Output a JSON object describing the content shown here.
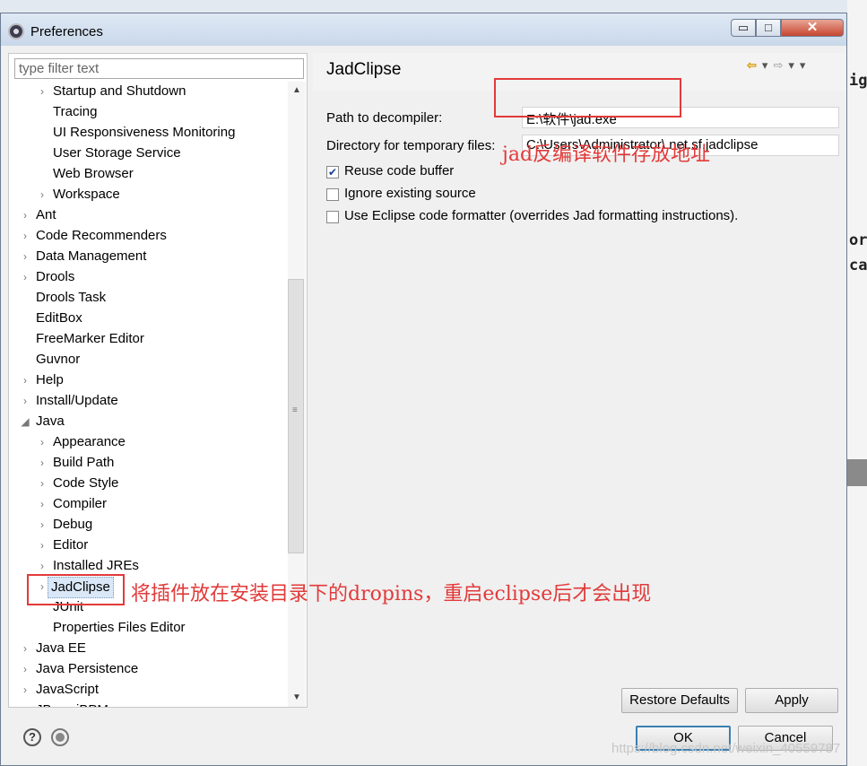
{
  "window": {
    "title": "Preferences",
    "controls": {
      "minimize": "▭",
      "maximize": "□",
      "close": "✕"
    }
  },
  "filter": {
    "placeholder": "type filter text"
  },
  "tree": {
    "items": [
      {
        "label": "Startup and Shutdown",
        "level": 2,
        "arrow": "›"
      },
      {
        "label": "Tracing",
        "level": 2,
        "arrow": ""
      },
      {
        "label": "UI Responsiveness Monitoring",
        "level": 2,
        "arrow": ""
      },
      {
        "label": "User Storage Service",
        "level": 2,
        "arrow": ""
      },
      {
        "label": "Web Browser",
        "level": 2,
        "arrow": ""
      },
      {
        "label": "Workspace",
        "level": 2,
        "arrow": "›"
      },
      {
        "label": "Ant",
        "level": 1,
        "arrow": "›"
      },
      {
        "label": "Code Recommenders",
        "level": 1,
        "arrow": "›"
      },
      {
        "label": "Data Management",
        "level": 1,
        "arrow": "›"
      },
      {
        "label": "Drools",
        "level": 1,
        "arrow": "›"
      },
      {
        "label": "Drools Task",
        "level": 1,
        "arrow": ""
      },
      {
        "label": "EditBox",
        "level": 1,
        "arrow": ""
      },
      {
        "label": "FreeMarker Editor",
        "level": 1,
        "arrow": ""
      },
      {
        "label": "Guvnor",
        "level": 1,
        "arrow": ""
      },
      {
        "label": "Help",
        "level": 1,
        "arrow": "›"
      },
      {
        "label": "Install/Update",
        "level": 1,
        "arrow": "›"
      },
      {
        "label": "Java",
        "level": 1,
        "arrow": "◢"
      },
      {
        "label": "Appearance",
        "level": 2,
        "arrow": "›"
      },
      {
        "label": "Build Path",
        "level": 2,
        "arrow": "›"
      },
      {
        "label": "Code Style",
        "level": 2,
        "arrow": "›"
      },
      {
        "label": "Compiler",
        "level": 2,
        "arrow": "›"
      },
      {
        "label": "Debug",
        "level": 2,
        "arrow": "›"
      },
      {
        "label": "Editor",
        "level": 2,
        "arrow": "›"
      },
      {
        "label": "Installed JREs",
        "level": 2,
        "arrow": "›"
      },
      {
        "label": "JadClipse",
        "level": 2,
        "arrow": "›",
        "selected": true
      },
      {
        "label": "JUnit",
        "level": 2,
        "arrow": ""
      },
      {
        "label": "Properties Files Editor",
        "level": 2,
        "arrow": ""
      },
      {
        "label": "Java EE",
        "level": 1,
        "arrow": "›"
      },
      {
        "label": "Java Persistence",
        "level": 1,
        "arrow": "›"
      },
      {
        "label": "JavaScript",
        "level": 1,
        "arrow": "›"
      },
      {
        "label": "JBoss jBPM",
        "level": 1,
        "arrow": "›"
      }
    ]
  },
  "page": {
    "title": "JadClipse",
    "nav": {
      "back": "⇦",
      "back_menu": "▾",
      "forward": "⇨",
      "forward_menu": "▾",
      "view_menu": "▾"
    },
    "path_label": "Path to decompiler:",
    "path_value": "E:\\软件\\jad.exe",
    "dir_label": "Directory for temporary files:",
    "dir_value": "C:\\Users\\Administrator\\.net.sf.jadclipse",
    "options": [
      {
        "label": "Reuse code buffer",
        "checked": true
      },
      {
        "label": "Ignore existing source",
        "checked": false
      },
      {
        "label": "Use Eclipse code formatter (overrides Jad formatting instructions).",
        "checked": false
      }
    ],
    "restore_defaults": "Restore Defaults",
    "apply": "Apply"
  },
  "footer": {
    "ok": "OK",
    "cancel": "Cancel",
    "help": "?"
  },
  "annotations": {
    "decompiler_note": "jad反编译软件存放地址",
    "plugin_note": "将插件放在安装目录下的dropins，重启eclipse后才会出现"
  },
  "background": {
    "right_chars": [
      "ig",
      "or",
      "ca"
    ]
  },
  "watermark": "https://blog.csdn.net/weixin_40559787",
  "colors": {
    "annotation_red": "#e23a3a",
    "selection_bg": "#d9e7f7"
  }
}
